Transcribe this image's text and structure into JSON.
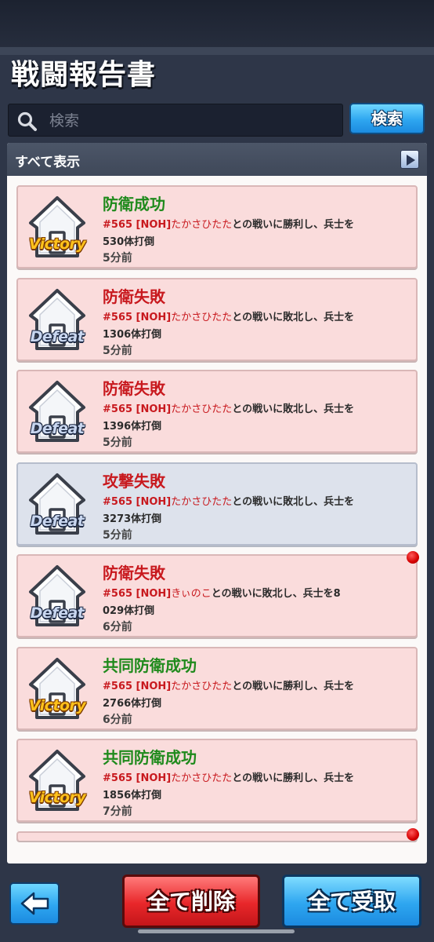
{
  "header": {
    "title": "戦闘報告書"
  },
  "search": {
    "placeholder": "検索",
    "value": "",
    "button_label": "検索"
  },
  "filter": {
    "label": "すべて表示"
  },
  "reports": [
    {
      "title": "防衛成功",
      "result": "win",
      "badge": "Victory",
      "tag": "#565 [NOH]",
      "name": "たかさひたた",
      "text": "との戦いに勝利し、兵士を",
      "count_line": "530体打倒",
      "time": "5分前",
      "theme": "pink",
      "unread": false
    },
    {
      "title": "防衛失敗",
      "result": "lose",
      "badge": "Defeat",
      "tag": "#565 [NOH]",
      "name": "たかさひたた",
      "text": "との戦いに敗北し、兵士を",
      "count_line": "1306体打倒",
      "time": "5分前",
      "theme": "pink",
      "unread": false
    },
    {
      "title": "防衛失敗",
      "result": "lose",
      "badge": "Defeat",
      "tag": "#565 [NOH]",
      "name": "たかさひたた",
      "text": "との戦いに敗北し、兵士を",
      "count_line": "1396体打倒",
      "time": "5分前",
      "theme": "pink",
      "unread": false
    },
    {
      "title": "攻撃失敗",
      "result": "lose",
      "badge": "Defeat",
      "tag": "#565 [NOH]",
      "name": "たかさひたた",
      "text": "との戦いに敗北し、兵士を",
      "count_line": "3273体打倒",
      "time": "5分前",
      "theme": "blue",
      "unread": false
    },
    {
      "title": "防衛失敗",
      "result": "lose",
      "badge": "Defeat",
      "tag": "#565 [NOH]",
      "name": "きぃのこ",
      "text": "との戦いに敗北し、兵士を8",
      "count_line": "029体打倒",
      "time": "6分前",
      "theme": "pink",
      "unread": true
    },
    {
      "title": "共同防衛成功",
      "result": "win",
      "badge": "Victory",
      "tag": "#565 [NOH]",
      "name": "たかさひたた",
      "text": "との戦いに勝利し、兵士を",
      "count_line": "2766体打倒",
      "time": "6分前",
      "theme": "pink",
      "unread": false
    },
    {
      "title": "共同防衛成功",
      "result": "win",
      "badge": "Victory",
      "tag": "#565 [NOH]",
      "name": "たかさひたた",
      "text": "との戦いに勝利し、兵士を",
      "count_line": "1856体打倒",
      "time": "7分前",
      "theme": "pink",
      "unread": false
    }
  ],
  "footer": {
    "delete_all": "全て削除",
    "receive_all": "全て受取"
  },
  "icons": {
    "search": "search-icon",
    "back": "back-arrow-icon",
    "filter_arrow": "triangle-right-icon",
    "house": "house-icon"
  },
  "colors": {
    "win": "#1f8a1c",
    "lose": "#c8191e",
    "accent_blue": "#2ea6f0",
    "danger_red": "#e8272a"
  }
}
